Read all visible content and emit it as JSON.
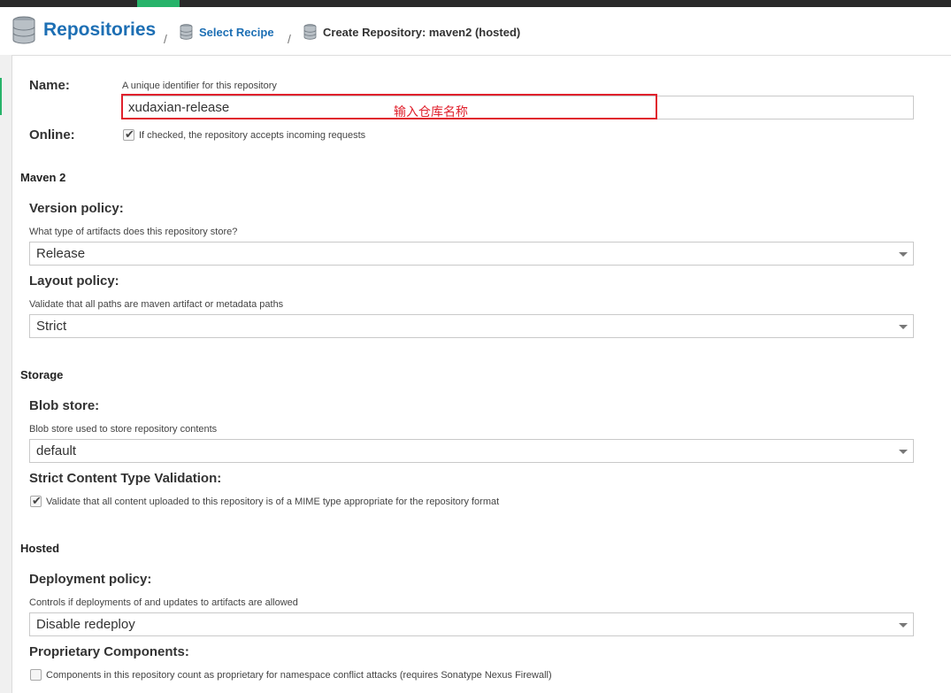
{
  "header": {
    "title": "Repositories",
    "separator": "/",
    "select_recipe": "Select Recipe",
    "current_page": "Create Repository: maven2 (hosted)"
  },
  "form": {
    "name": {
      "label": "Name:",
      "help": "A unique identifier for this repository",
      "value": "xudaxian-release",
      "annotation": "输入仓库名称"
    },
    "online": {
      "label": "Online:",
      "checked": true,
      "help": "If checked, the repository accepts incoming requests"
    },
    "maven2": {
      "section": "Maven 2",
      "version_policy": {
        "label": "Version policy:",
        "help": "What type of artifacts does this repository store?",
        "value": "Release"
      },
      "layout_policy": {
        "label": "Layout policy:",
        "help": "Validate that all paths are maven artifact or metadata paths",
        "value": "Strict"
      }
    },
    "storage": {
      "section": "Storage",
      "blob_store": {
        "label": "Blob store:",
        "help": "Blob store used to store repository contents",
        "value": "default"
      },
      "strict_content": {
        "label": "Strict Content Type Validation:",
        "checked": true,
        "help": "Validate that all content uploaded to this repository is of a MIME type appropriate for the repository format"
      }
    },
    "hosted": {
      "section": "Hosted",
      "deployment_policy": {
        "label": "Deployment policy:",
        "help": "Controls if deployments of and updates to artifacts are allowed",
        "value": "Disable redeploy"
      },
      "proprietary": {
        "label": "Proprietary Components:",
        "checked": false,
        "help": "Components in this repository count as proprietary for namespace conflict attacks (requires Sonatype Nexus Firewall)"
      }
    }
  },
  "icons": {
    "repositories": "database-icon",
    "select_recipe": "database-icon",
    "current": "database-icon",
    "checkmark": "✔",
    "dropdown": "chevron-down-icon"
  },
  "colors": {
    "link": "#1d6fb4",
    "annotation": "#e0212d",
    "active_tab": "#27b36a"
  }
}
